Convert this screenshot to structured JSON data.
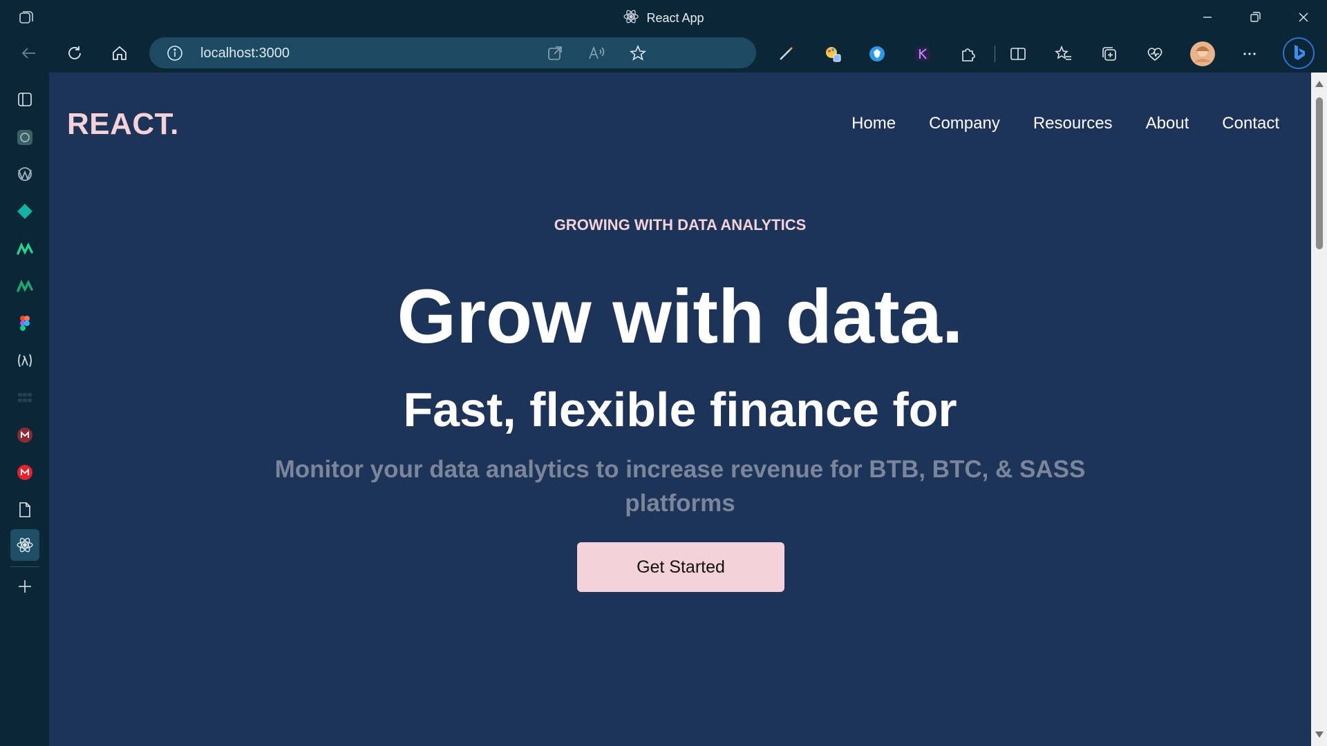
{
  "window": {
    "title": "React App",
    "icons": [
      "tab-actions-icon",
      "react-icon",
      "minimize-icon",
      "restore-icon",
      "close-icon"
    ]
  },
  "toolbar": {
    "url": "localhost:3000",
    "icons": [
      "back-icon",
      "refresh-icon",
      "home-icon",
      "info-icon",
      "open-in-app-icon",
      "read-aloud-icon",
      "favorite-star-icon",
      "pen-icon",
      "color-picker-icon",
      "bitwarden-icon",
      "kite-icon",
      "extensions-icon",
      "split-screen-icon",
      "favorites-icon",
      "collections-icon",
      "browser-essentials-icon",
      "profile-avatar",
      "more-icon",
      "bing-copilot-icon"
    ]
  },
  "sidebar": {
    "items": [
      "tab-panel-icon",
      "chatgpt-icon",
      "app-icon",
      "diamond-app-icon",
      "monday-icon",
      "monday-alt-icon",
      "figma-icon",
      "lambda-icon",
      "grid-app-icon",
      "gmail-alt-icon",
      "gmail-icon",
      "document-icon",
      "react-app-icon",
      "add-icon"
    ]
  },
  "page": {
    "logo": "REACT.",
    "nav": [
      "Home",
      "Company",
      "Resources",
      "About",
      "Contact"
    ],
    "eyebrow": "GROWING WITH DATA ANALYTICS",
    "headline": "Grow with data.",
    "subheadline": "Fast, flexible finance for",
    "description": "Monitor your data analytics to increase revenue for BTB, BTC, & SASS platforms",
    "cta": "Get Started"
  },
  "colors": {
    "page_background": "#1e3358",
    "accent_pink": "#f3d2d9",
    "muted_text": "#7a869c",
    "browser_chrome": "#0b2636"
  }
}
